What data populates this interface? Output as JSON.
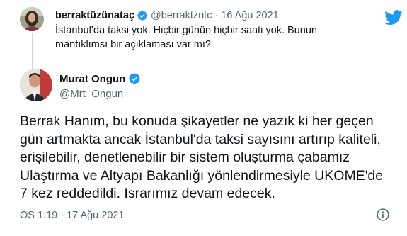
{
  "parent_tweet": {
    "display_name": "berraktüzünataç",
    "handle": "@berraktzntc",
    "separator": "·",
    "date": "16 Ağu 2021",
    "lines": [
      "İstanbul’da taksi yok. Hiçbir günün hiçbir saati yok. Bunun",
      "mantıklımsı bir açıklaması var mı?"
    ],
    "verified": true
  },
  "tweet": {
    "display_name": "Murat Ongun",
    "handle": "@Mrt_Ongun",
    "verified": true,
    "lines": [
      "Berrak Hanım, bu konuda şikayetler ne yazık ki her geçen",
      "gün artmakta ancak İstanbul'da taksi sayısını artırıp kaliteli,",
      "erişilebilir, denetlenebilir bir sistem oluşturma çabamız",
      "Ulaştırma ve Altyapı Bakanlığı yönlendirmesiyle UKOME'de",
      "7 kez reddedildi. Israrımız devam edecek."
    ],
    "timestamp": "ÖS 1:19 · 17 Ağu 2021"
  },
  "icons": {
    "brand": "twitter-bird-icon",
    "verified": "verified-badge-icon",
    "info": "info-icon"
  },
  "colors": {
    "twitter_blue": "#1d9bf0",
    "text_primary": "#0f1419",
    "text_secondary": "#536471",
    "thread_line": "#cfd9de"
  }
}
